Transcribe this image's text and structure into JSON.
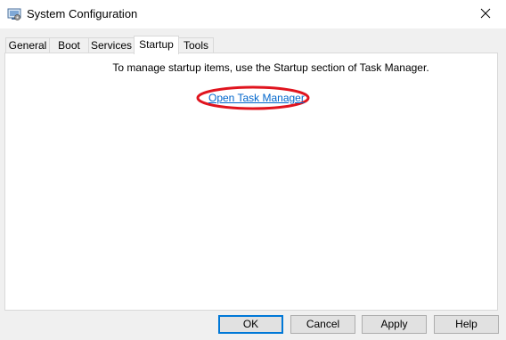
{
  "window": {
    "title": "System Configuration",
    "icon": "system-config-icon",
    "close_icon": "close-icon"
  },
  "tabs": [
    {
      "label": "General",
      "active": false
    },
    {
      "label": "Boot",
      "active": false
    },
    {
      "label": "Services",
      "active": false
    },
    {
      "label": "Startup",
      "active": true
    },
    {
      "label": "Tools",
      "active": false
    }
  ],
  "startup": {
    "info_text": "To manage startup items, use the Startup section of Task Manager.",
    "link_text": "Open Task Manager",
    "highlight_color": "#e0141e"
  },
  "buttons": {
    "ok": "OK",
    "cancel": "Cancel",
    "apply": "Apply",
    "help": "Help"
  },
  "colors": {
    "link": "#0066cc",
    "accent": "#0078d7"
  }
}
